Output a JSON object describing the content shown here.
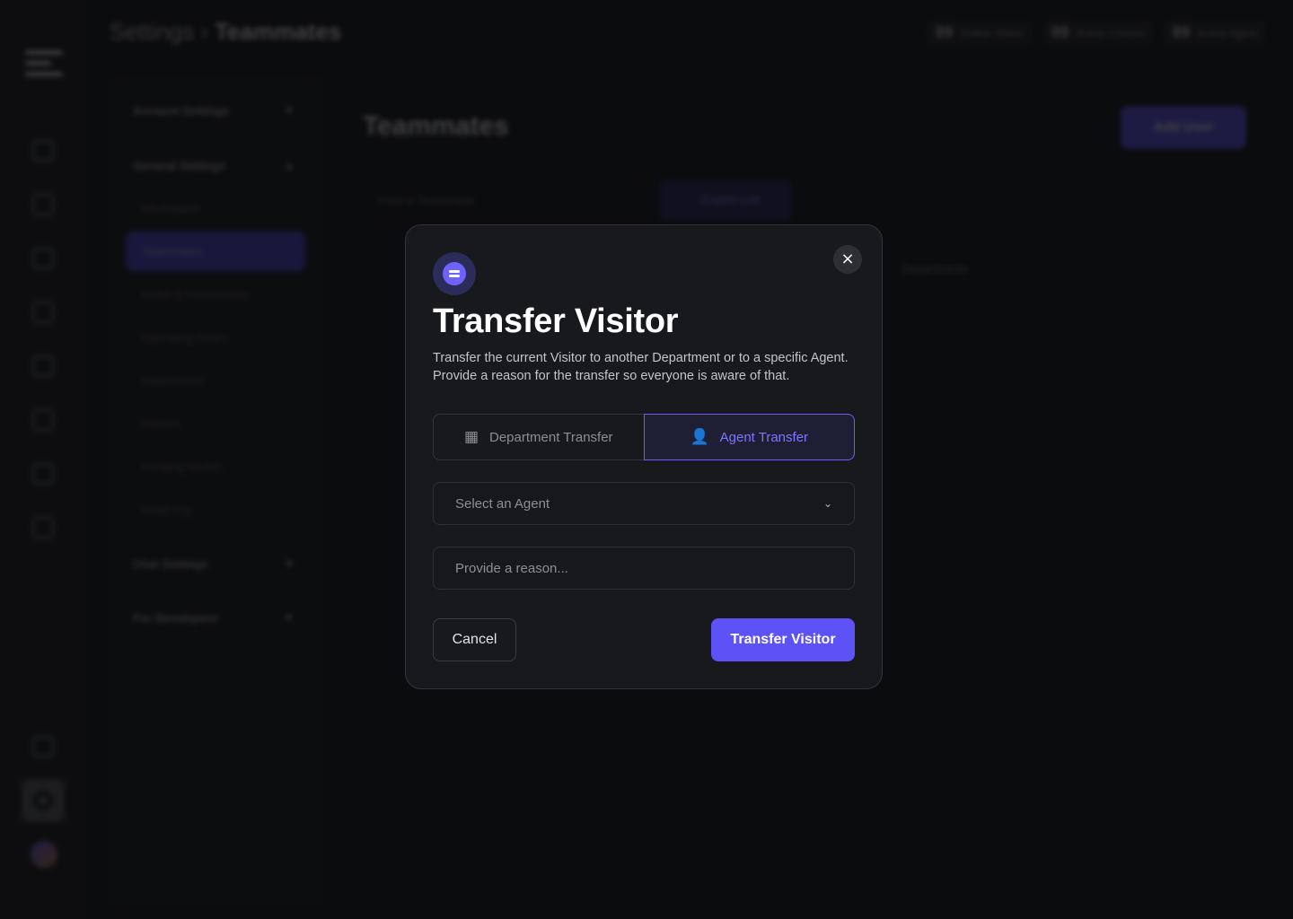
{
  "background": {
    "breadcrumb": {
      "parent": "Settings",
      "separator": "›",
      "current": "Teammates"
    },
    "stats": [
      {
        "value": "99",
        "label": "Online Visitor"
      },
      {
        "value": "99",
        "label": "Active Convos"
      },
      {
        "value": "99",
        "label": "Active Agent"
      }
    ],
    "sidebar": {
      "sections": [
        "Account Settings",
        "General Settings",
        "Chat Settings",
        "For Developers"
      ],
      "items": [
        "Workspace",
        "Teammates",
        "Roles & Permissions",
        "Operating Hours",
        "Department",
        "Visitors",
        "Pending Invites",
        "Audit Log"
      ]
    },
    "page_title": "Teammates",
    "add_user_label": "Add User",
    "find_placeholder": "Find a Teammate",
    "export_label": "Export List",
    "departments_header": "Departments"
  },
  "modal": {
    "title": "Transfer Visitor",
    "description": "Transfer the current Visitor to another Department or to a specific Agent. Provide a reason for the transfer so everyone is aware of that.",
    "close_icon": "×",
    "tabs": [
      {
        "label": "Department Transfer",
        "icon": "building-icon",
        "glyph": "▦",
        "active": false
      },
      {
        "label": "Agent Transfer",
        "icon": "user-icon",
        "glyph": "👤",
        "active": true
      }
    ],
    "agent_select": {
      "placeholder": "Select an Agent",
      "chevron": "⌄"
    },
    "reason_input": {
      "placeholder": "Provide a reason..."
    },
    "cancel_label": "Cancel",
    "submit_label": "Transfer Visitor"
  },
  "colors": {
    "accent": "#5c52f5",
    "accent_text": "#7e75ff",
    "modal_bg": "#18191c",
    "page_bg": "#0e0f11"
  }
}
